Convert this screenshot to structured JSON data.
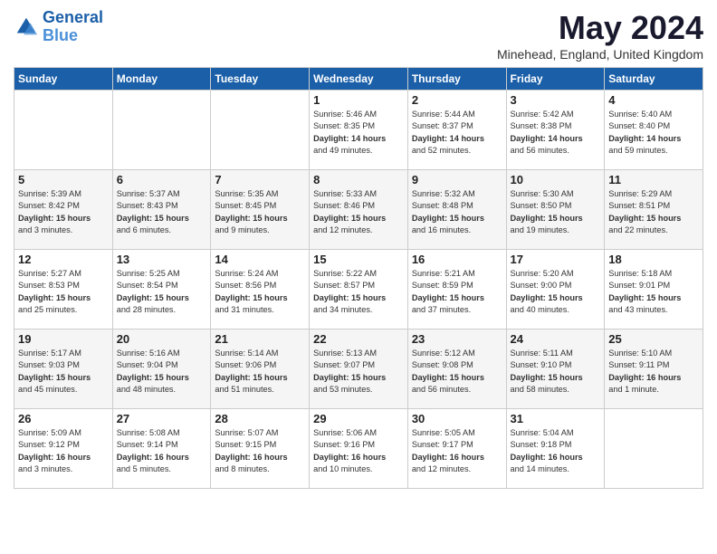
{
  "header": {
    "logo_line1": "General",
    "logo_line2": "Blue",
    "month": "May 2024",
    "location": "Minehead, England, United Kingdom"
  },
  "days_of_week": [
    "Sunday",
    "Monday",
    "Tuesday",
    "Wednesday",
    "Thursday",
    "Friday",
    "Saturday"
  ],
  "weeks": [
    [
      {
        "day": "",
        "content": ""
      },
      {
        "day": "",
        "content": ""
      },
      {
        "day": "",
        "content": ""
      },
      {
        "day": "1",
        "content": "Sunrise: 5:46 AM\nSunset: 8:35 PM\nDaylight: 14 hours\nand 49 minutes."
      },
      {
        "day": "2",
        "content": "Sunrise: 5:44 AM\nSunset: 8:37 PM\nDaylight: 14 hours\nand 52 minutes."
      },
      {
        "day": "3",
        "content": "Sunrise: 5:42 AM\nSunset: 8:38 PM\nDaylight: 14 hours\nand 56 minutes."
      },
      {
        "day": "4",
        "content": "Sunrise: 5:40 AM\nSunset: 8:40 PM\nDaylight: 14 hours\nand 59 minutes."
      }
    ],
    [
      {
        "day": "5",
        "content": "Sunrise: 5:39 AM\nSunset: 8:42 PM\nDaylight: 15 hours\nand 3 minutes."
      },
      {
        "day": "6",
        "content": "Sunrise: 5:37 AM\nSunset: 8:43 PM\nDaylight: 15 hours\nand 6 minutes."
      },
      {
        "day": "7",
        "content": "Sunrise: 5:35 AM\nSunset: 8:45 PM\nDaylight: 15 hours\nand 9 minutes."
      },
      {
        "day": "8",
        "content": "Sunrise: 5:33 AM\nSunset: 8:46 PM\nDaylight: 15 hours\nand 12 minutes."
      },
      {
        "day": "9",
        "content": "Sunrise: 5:32 AM\nSunset: 8:48 PM\nDaylight: 15 hours\nand 16 minutes."
      },
      {
        "day": "10",
        "content": "Sunrise: 5:30 AM\nSunset: 8:50 PM\nDaylight: 15 hours\nand 19 minutes."
      },
      {
        "day": "11",
        "content": "Sunrise: 5:29 AM\nSunset: 8:51 PM\nDaylight: 15 hours\nand 22 minutes."
      }
    ],
    [
      {
        "day": "12",
        "content": "Sunrise: 5:27 AM\nSunset: 8:53 PM\nDaylight: 15 hours\nand 25 minutes."
      },
      {
        "day": "13",
        "content": "Sunrise: 5:25 AM\nSunset: 8:54 PM\nDaylight: 15 hours\nand 28 minutes."
      },
      {
        "day": "14",
        "content": "Sunrise: 5:24 AM\nSunset: 8:56 PM\nDaylight: 15 hours\nand 31 minutes."
      },
      {
        "day": "15",
        "content": "Sunrise: 5:22 AM\nSunset: 8:57 PM\nDaylight: 15 hours\nand 34 minutes."
      },
      {
        "day": "16",
        "content": "Sunrise: 5:21 AM\nSunset: 8:59 PM\nDaylight: 15 hours\nand 37 minutes."
      },
      {
        "day": "17",
        "content": "Sunrise: 5:20 AM\nSunset: 9:00 PM\nDaylight: 15 hours\nand 40 minutes."
      },
      {
        "day": "18",
        "content": "Sunrise: 5:18 AM\nSunset: 9:01 PM\nDaylight: 15 hours\nand 43 minutes."
      }
    ],
    [
      {
        "day": "19",
        "content": "Sunrise: 5:17 AM\nSunset: 9:03 PM\nDaylight: 15 hours\nand 45 minutes."
      },
      {
        "day": "20",
        "content": "Sunrise: 5:16 AM\nSunset: 9:04 PM\nDaylight: 15 hours\nand 48 minutes."
      },
      {
        "day": "21",
        "content": "Sunrise: 5:14 AM\nSunset: 9:06 PM\nDaylight: 15 hours\nand 51 minutes."
      },
      {
        "day": "22",
        "content": "Sunrise: 5:13 AM\nSunset: 9:07 PM\nDaylight: 15 hours\nand 53 minutes."
      },
      {
        "day": "23",
        "content": "Sunrise: 5:12 AM\nSunset: 9:08 PM\nDaylight: 15 hours\nand 56 minutes."
      },
      {
        "day": "24",
        "content": "Sunrise: 5:11 AM\nSunset: 9:10 PM\nDaylight: 15 hours\nand 58 minutes."
      },
      {
        "day": "25",
        "content": "Sunrise: 5:10 AM\nSunset: 9:11 PM\nDaylight: 16 hours\nand 1 minute."
      }
    ],
    [
      {
        "day": "26",
        "content": "Sunrise: 5:09 AM\nSunset: 9:12 PM\nDaylight: 16 hours\nand 3 minutes."
      },
      {
        "day": "27",
        "content": "Sunrise: 5:08 AM\nSunset: 9:14 PM\nDaylight: 16 hours\nand 5 minutes."
      },
      {
        "day": "28",
        "content": "Sunrise: 5:07 AM\nSunset: 9:15 PM\nDaylight: 16 hours\nand 8 minutes."
      },
      {
        "day": "29",
        "content": "Sunrise: 5:06 AM\nSunset: 9:16 PM\nDaylight: 16 hours\nand 10 minutes."
      },
      {
        "day": "30",
        "content": "Sunrise: 5:05 AM\nSunset: 9:17 PM\nDaylight: 16 hours\nand 12 minutes."
      },
      {
        "day": "31",
        "content": "Sunrise: 5:04 AM\nSunset: 9:18 PM\nDaylight: 16 hours\nand 14 minutes."
      },
      {
        "day": "",
        "content": ""
      }
    ]
  ]
}
